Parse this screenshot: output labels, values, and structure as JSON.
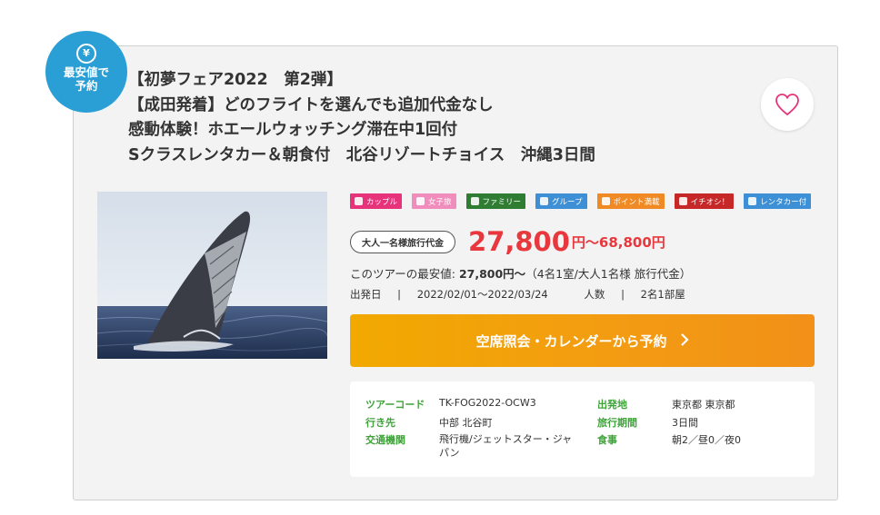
{
  "badge": {
    "icon": "yen-icon",
    "line1": "最安値で",
    "line2": "予約"
  },
  "title": {
    "line1": "【初夢フェア2022　第2弾】",
    "line2": "【成田発着】どのフライトを選んでも追加代金なし",
    "line3": "感動体験！ホエールウォッチング滞在中1回付",
    "line4": "Sクラスレンタカー＆朝食付　北谷リゾートチョイス　沖縄3日間"
  },
  "favorite": {
    "icon": "heart-icon"
  },
  "tags": [
    {
      "label": "カップル",
      "color": "#e6337a"
    },
    {
      "label": "女子旅",
      "color": "#f08dbd"
    },
    {
      "label": "ファミリー",
      "color": "#2e7d32"
    },
    {
      "label": "グループ",
      "color": "#3d8fd6"
    },
    {
      "label": "ポイント満載",
      "color": "#f08a24"
    },
    {
      "label": "イチオシ！",
      "color": "#c62828"
    },
    {
      "label": "レンタカー付",
      "color": "#3d8fd6"
    }
  ],
  "price": {
    "pill": "大人一名様旅行代金",
    "main": "27,800",
    "rest": "円～68,800円"
  },
  "lowest": {
    "prefix": "このツアーの最安値: ",
    "value": "27,800円～",
    "suffix": "（4名1室/大人1名様 旅行代金）"
  },
  "meta": {
    "dep_label": "出発日",
    "sep": "|",
    "dep_value": "2022/02/01～2022/03/24",
    "people_label": "人数",
    "people_value": "2名1部屋"
  },
  "cta": {
    "label": "空席照会・カレンダーから予約",
    "icon": "chevron-right-icon"
  },
  "info": {
    "tour_code_label": "ツアーコード",
    "tour_code": "TK-FOG2022-OCW3",
    "destination_label": "行き先",
    "destination": "中部 北谷町",
    "transport_label": "交通機関",
    "transport": "飛行機/ジェットスター・ジャパン",
    "departure_label": "出発地",
    "departure": "東京都 東京都",
    "period_label": "旅行期間",
    "period": "3日間",
    "meals_label": "食事",
    "meals": "朝2／昼0／夜0"
  },
  "colors": {
    "accent_red": "#e8383d",
    "badge_blue": "#2a9fd6",
    "cta_orange": "#f39c12",
    "label_green": "#3fa33a"
  }
}
